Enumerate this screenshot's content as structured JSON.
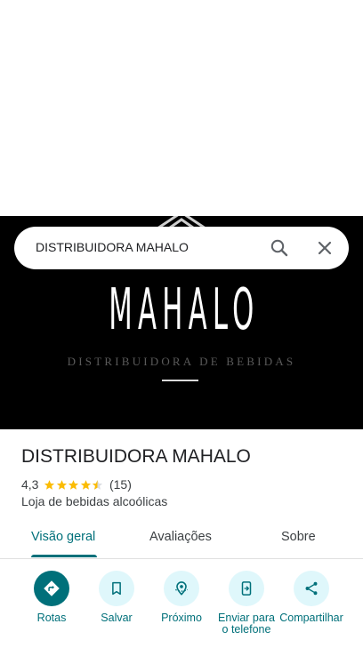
{
  "search": {
    "query": "DISTRIBUIDORA MAHALO"
  },
  "hero": {
    "brand_name": "MAHALO",
    "brand_tagline": "DISTRIBUIDORA DE BEBIDAS"
  },
  "place": {
    "name": "DISTRIBUIDORA MAHALO",
    "rating": "4,3",
    "rating_value": 4.3,
    "review_count": "(15)",
    "category": "Loja de bebidas alcoólicas"
  },
  "tabs": [
    {
      "label": "Visão geral",
      "active": true
    },
    {
      "label": "Avaliações",
      "active": false
    },
    {
      "label": "Sobre",
      "active": false
    }
  ],
  "actions": [
    {
      "label": "Rotas",
      "icon": "directions-icon"
    },
    {
      "label": "Salvar",
      "icon": "bookmark-icon"
    },
    {
      "label": "Próximo",
      "icon": "nearby-icon"
    },
    {
      "label": "Enviar para o telefone",
      "icon": "send-to-phone-icon"
    },
    {
      "label": "Compartilhar",
      "icon": "share-icon"
    }
  ],
  "colors": {
    "accent": "#00707a",
    "action_bg": "#dff7fb",
    "star": "#fbbc04",
    "hero_bg": "#000000"
  }
}
